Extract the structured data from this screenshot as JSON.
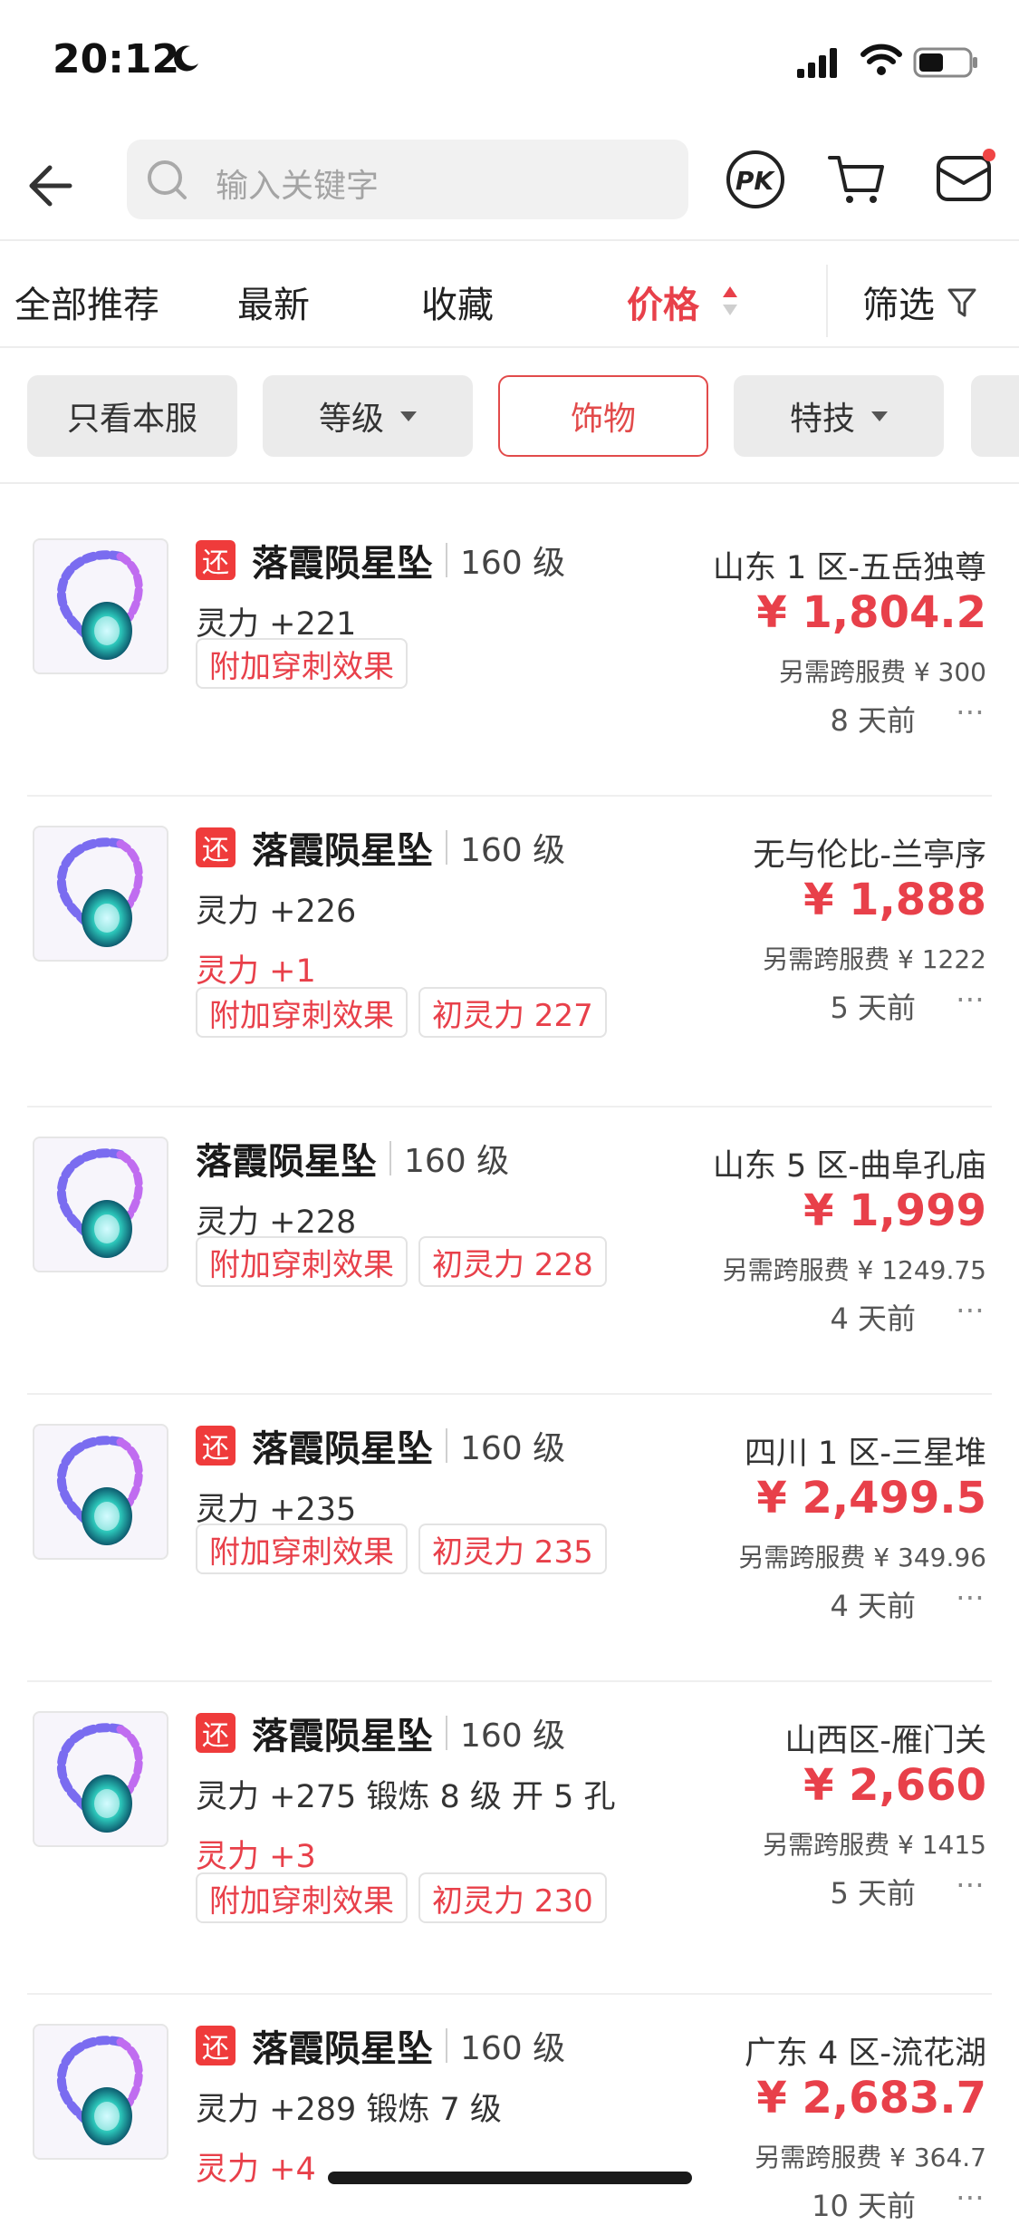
{
  "status": {
    "time": "20:12"
  },
  "search": {
    "placeholder": "输入关键字"
  },
  "sort_tabs": [
    {
      "label": "全部推荐"
    },
    {
      "label": "最新"
    },
    {
      "label": "收藏"
    },
    {
      "label": "价格"
    },
    {
      "label": "筛选"
    }
  ],
  "chips": [
    {
      "label": "只看本服"
    },
    {
      "label": "等级"
    },
    {
      "label": "饰物"
    },
    {
      "label": "特技"
    }
  ],
  "items": [
    {
      "huan": "还",
      "name": "落霞陨星坠",
      "level": "160 级",
      "stat": "灵力 +221",
      "bonus": "",
      "tags": [
        "附加穿刺效果"
      ],
      "server": "山东 1 区-五岳独尊",
      "price": "¥ 1,804.2",
      "fee": "另需跨服费 ¥ 300",
      "age": "8 天前"
    },
    {
      "huan": "还",
      "name": "落霞陨星坠",
      "level": "160 级",
      "stat": "灵力 +226",
      "bonus": "灵力 +1",
      "tags": [
        "附加穿刺效果",
        "初灵力 227"
      ],
      "server": "无与伦比-兰亭序",
      "price": "¥ 1,888",
      "fee": "另需跨服费 ¥ 1222",
      "age": "5 天前"
    },
    {
      "huan": "",
      "name": "落霞陨星坠",
      "level": "160 级",
      "stat": "灵力 +228",
      "bonus": "",
      "tags": [
        "附加穿刺效果",
        "初灵力 228"
      ],
      "server": "山东 5 区-曲阜孔庙",
      "price": "¥ 1,999",
      "fee": "另需跨服费 ¥ 1249.75",
      "age": "4 天前"
    },
    {
      "huan": "还",
      "name": "落霞陨星坠",
      "level": "160 级",
      "stat": "灵力 +235",
      "bonus": "",
      "tags": [
        "附加穿刺效果",
        "初灵力 235"
      ],
      "server": "四川 1 区-三星堆",
      "price": "¥ 2,499.5",
      "fee": "另需跨服费 ¥ 349.96",
      "age": "4 天前"
    },
    {
      "huan": "还",
      "name": "落霞陨星坠",
      "level": "160 级",
      "stat": "灵力 +275 锻炼 8 级 开 5 孔",
      "bonus": "灵力 +3",
      "tags": [
        "附加穿刺效果",
        "初灵力 230"
      ],
      "server": "山西区-雁门关",
      "price": "¥ 2,660",
      "fee": "另需跨服费 ¥ 1415",
      "age": "5 天前"
    },
    {
      "huan": "还",
      "name": "落霞陨星坠",
      "level": "160 级",
      "stat": "灵力 +289 锻炼 7 级",
      "bonus": "灵力 +4",
      "tags": [],
      "server": "广东 4 区-流花湖",
      "price": "¥ 2,683.7",
      "fee": "另需跨服费 ¥ 364.7",
      "age": "10 天前"
    }
  ],
  "colors": {
    "accent": "#e8404a",
    "tag_border": "#e3e3e3",
    "chip_bg": "#ebebeb"
  }
}
